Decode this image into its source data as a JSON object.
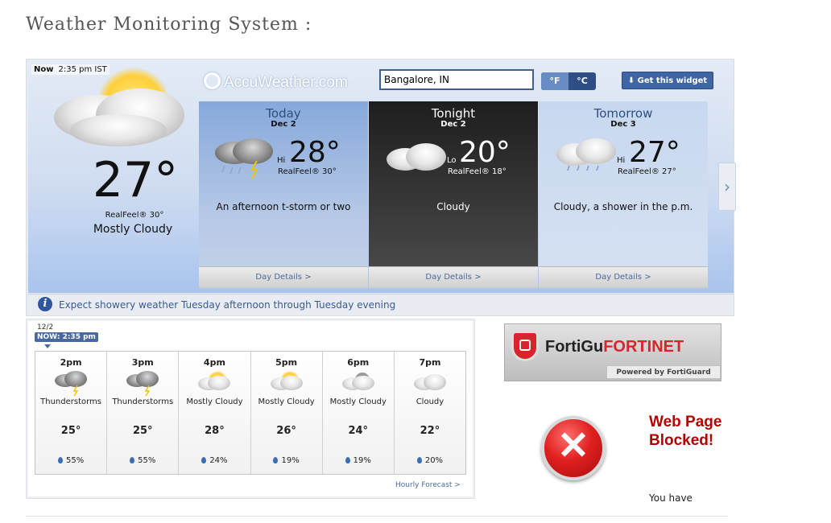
{
  "page": {
    "title": "Weather Monitoring System :"
  },
  "widget": {
    "current": {
      "now_label": "Now",
      "time": "2:35 pm IST",
      "temp": "27°",
      "realfeel": "RealFeel® 30°",
      "condition": "Mostly Cloudy"
    },
    "brand": "AccuWeather.com",
    "location_value": "Bangalore, IN",
    "units": {
      "f": "°F",
      "c": "°C",
      "selected": "°F"
    },
    "get_widget_label": "Get this widget",
    "days": [
      {
        "title": "Today",
        "date": "Dec 2",
        "hilo": "Hi",
        "temp": "28°",
        "realfeel": "RealFeel® 30°",
        "text": "An afternoon t-storm or two",
        "details": "Day Details >"
      },
      {
        "title": "Tonight",
        "date": "Dec 2",
        "hilo": "Lo",
        "temp": "20°",
        "realfeel": "RealFeel® 18°",
        "text": "Cloudy",
        "details": "Day Details >"
      },
      {
        "title": "Tomorrow",
        "date": "Dec 3",
        "hilo": "Hi",
        "temp": "27°",
        "realfeel": "RealFeel® 27°",
        "text": "Cloudy, a shower in the p.m.",
        "details": "Day Details >"
      }
    ],
    "next_arrow": "›",
    "alert_text": "Expect showery weather Tuesday afternoon through Tuesday evening"
  },
  "hourly": {
    "date": "12/2",
    "now_badge": "NOW: 2:35 pm",
    "hours": [
      {
        "time": "2pm",
        "icon": "thunderstorm-icon",
        "condition": "Thunderstorms",
        "temp": "25°",
        "precip": "55%"
      },
      {
        "time": "3pm",
        "icon": "thunderstorm-icon",
        "condition": "Thunderstorms",
        "temp": "25°",
        "precip": "55%"
      },
      {
        "time": "4pm",
        "icon": "mostly-cloudy-icon",
        "condition": "Mostly Cloudy",
        "temp": "28°",
        "precip": "24%"
      },
      {
        "time": "5pm",
        "icon": "mostly-cloudy-icon",
        "condition": "Mostly Cloudy",
        "temp": "26°",
        "precip": "19%"
      },
      {
        "time": "6pm",
        "icon": "mostly-cloudy-night-icon",
        "condition": "Mostly Cloudy",
        "temp": "24°",
        "precip": "19%"
      },
      {
        "time": "7pm",
        "icon": "cloudy-icon",
        "condition": "Cloudy",
        "temp": "22°",
        "precip": "20%"
      }
    ],
    "forecast_link": "Hourly Forecast >"
  },
  "blocked": {
    "brand_text_prefix": "FortiGu",
    "brand_text": "FORTINET",
    "powered_by": "Powered by FortiGuard",
    "title": "Web Page Blocked!",
    "body": "You have"
  }
}
